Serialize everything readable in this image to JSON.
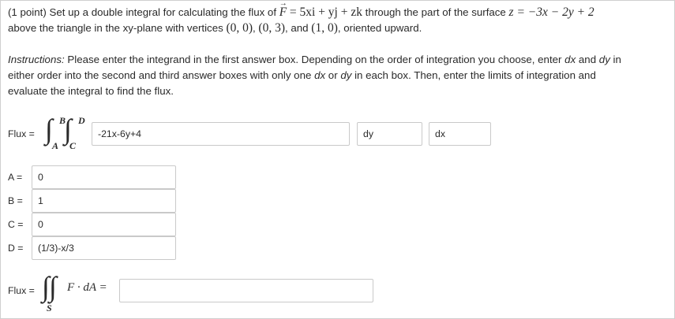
{
  "question": {
    "prefix": "(1 point) Set up a double integral for calculating the flux of ",
    "field_sym": "F",
    "field_eq": "= 5xi + yj + zk",
    "through_text": " through the part of the surface ",
    "surface_eq": "z = −3x − 2y + 2",
    "line2_pre": "above the triangle in the xy-plane with vertices ",
    "v1": "(0, 0)",
    "comma1": ",",
    "v2": "(0, 3)",
    "comma2": ", and",
    "v3": "(1, 0)",
    "line2_post": ", oriented upward."
  },
  "instructions": {
    "label": "Instructions:",
    "line1": " Please enter the integrand in the first answer box. Depending on the order of integration you choose, enter ",
    "dx": "dx",
    "and": " and ",
    "dy": "dy",
    "in": " in",
    "line2a": "either order into the second and third answer boxes with only one ",
    "dx2": "dx",
    "or": " or ",
    "dy2": "dy",
    "line2b": " in each box. Then, enter the limits of integration and",
    "line3": "evaluate the integral to find the flux."
  },
  "integral": {
    "flux_label": "Flux =",
    "upper_outer": "B",
    "upper_inner": "D",
    "lower_outer": "A",
    "lower_inner": "C",
    "integrand_value": "-21x-6y+4",
    "first_diff_value": "dy",
    "second_diff_value": "dx"
  },
  "limits": [
    {
      "label": "A =",
      "value": "0"
    },
    {
      "label": "B =",
      "value": "1"
    },
    {
      "label": "C =",
      "value": "0"
    },
    {
      "label": "D =",
      "value": "(1/3)-x/3"
    }
  ],
  "flux_surface": {
    "flux_label": "Flux =",
    "integrand": "F · dA =",
    "surface_sub": "S",
    "answer_value": ""
  }
}
